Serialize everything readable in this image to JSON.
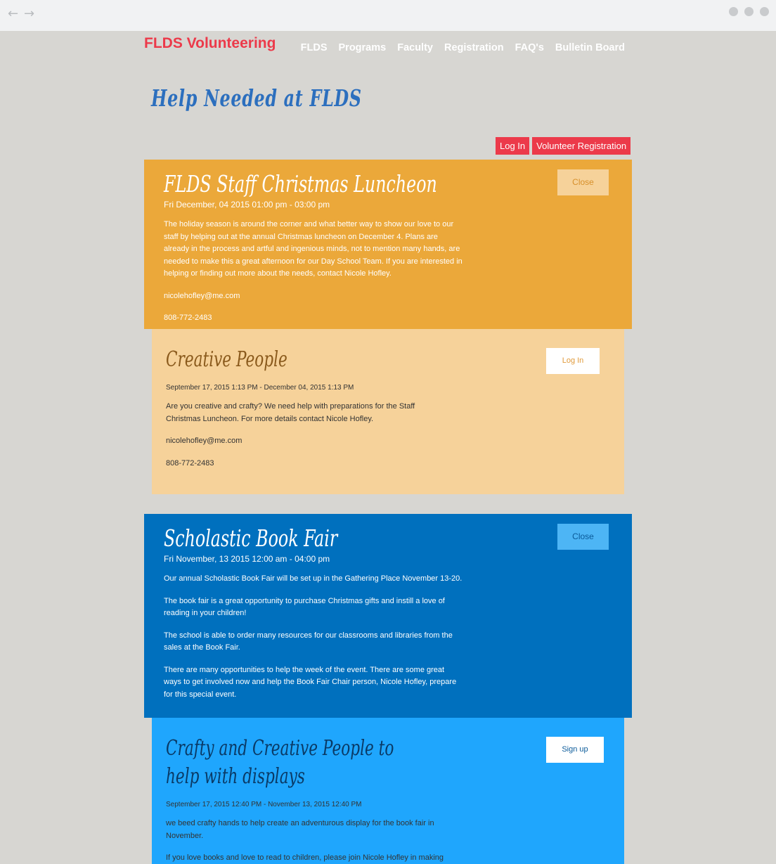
{
  "browser": {
    "back_icon": "←",
    "forward_icon": "→"
  },
  "site": {
    "brand": "FLDS Volunteering",
    "nav": [
      "FLDS",
      "Programs",
      "Faculty",
      "Registration",
      "FAQ's",
      "Bulletin Board"
    ]
  },
  "page_title": "Help Needed at FLDS",
  "auth": {
    "login": "Log In",
    "register": "Volunteer Registration"
  },
  "events": [
    {
      "title": "FLDS Staff Christmas Luncheon",
      "date": "Fri December, 04 2015 01:00 pm - 03:00 pm",
      "close_label": "Close",
      "paragraphs": [
        "The holiday season is around the corner and what better way to show our love to our staff by helping out at the annual Christmas luncheon on December 4.  Plans are already in the process and artful and ingenious minds, not to mention many hands, are needed to make this a great afternoon for our Day School Team.  If you are interested in helping or finding out more about the needs, contact Nicole Hofley.",
        "nicolehofley@me.com",
        "808-772-2483"
      ],
      "color": "#eba83a"
    },
    {
      "title": "Scholastic Book Fair",
      "date": "Fri November, 13 2015 12:00 am - 04:00 pm",
      "close_label": "Close",
      "paragraphs": [
        "Our annual Scholastic Book Fair will be set up in the Gathering Place November 13-20.",
        "The book fair is a great opportunity to purchase Christmas gifts and instill a love of reading in your children!",
        "The school is able to order many resources for our classrooms and libraries from the sales at the Book Fair.",
        "There are many opportunities to help the week of the event.  There are some great ways to get involved now and help the Book Fair Chair person, Nicole Hofley, prepare for this special event."
      ],
      "color": "#0070be"
    }
  ],
  "roles": [
    {
      "title": "Creative People",
      "date": "September 17, 2015 1:13 PM - December 04, 2015 1:13 PM",
      "action_label": "Log In",
      "paragraphs": [
        "Are you creative and crafty?  We need help with preparations for the Staff Christmas Luncheon.  For more details contact Nicole Hofley.",
        "nicolehofley@me.com",
        "808-772-2483"
      ],
      "color": "#f6d29a"
    },
    {
      "title": "Crafty and Creative People to help with displays",
      "date": "September 17, 2015 12:40 PM - November 13, 2015 12:40 PM",
      "action_label": "Sign up",
      "paragraphs": [
        "we beed crafty hands to help create an adventurous display for the book fair in November.",
        "If you love books and love to read to children, please join Nicole Hofley in making"
      ],
      "color": "#1fa6fd"
    }
  ]
}
